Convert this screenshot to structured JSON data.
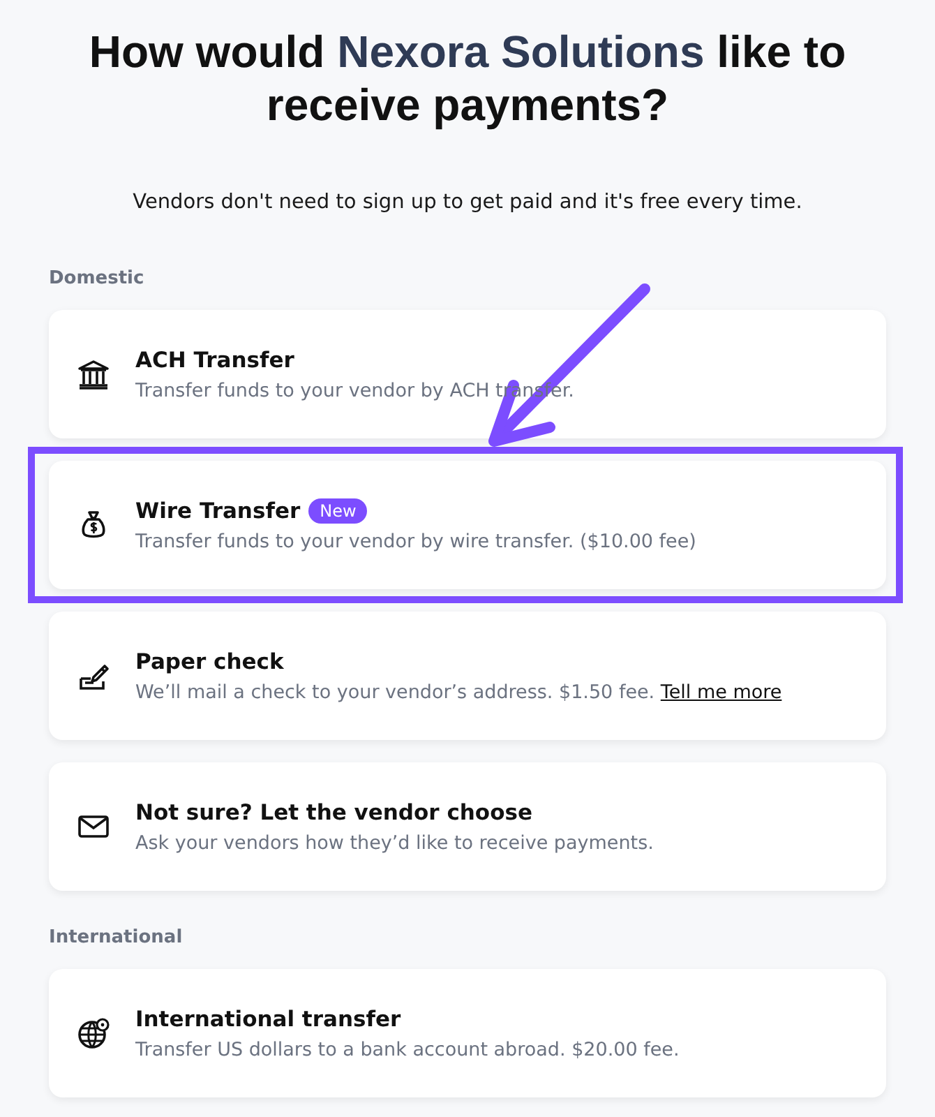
{
  "heading": {
    "before": "How would ",
    "company": "Nexora Solutions",
    "after": " like to receive payments?"
  },
  "subtitle": "Vendors don't need to sign up to get paid and it's free every time.",
  "sections": [
    {
      "label": "Domestic",
      "options": [
        {
          "kind": "bank",
          "title": "ACH Transfer",
          "description": "Transfer funds to your vendor by ACH transfer.",
          "selected": false
        },
        {
          "kind": "moneybag",
          "title": "Wire Transfer",
          "badge": "New",
          "description": "Transfer funds to your vendor by wire transfer. ($10.00 fee)",
          "selected": true
        },
        {
          "kind": "check",
          "title": "Paper check",
          "description": "We’ll mail a check to your vendor’s address. $1.50 fee.",
          "link": "Tell me more",
          "selected": false
        },
        {
          "kind": "envelope",
          "title": "Not sure? Let the vendor choose",
          "description": "Ask your vendors how they’d like to receive payments.",
          "selected": false
        }
      ]
    },
    {
      "label": "International",
      "options": [
        {
          "kind": "globe",
          "title": "International transfer",
          "description": "Transfer US dollars to a bank account abroad. $20.00 fee.",
          "selected": false
        }
      ]
    }
  ]
}
